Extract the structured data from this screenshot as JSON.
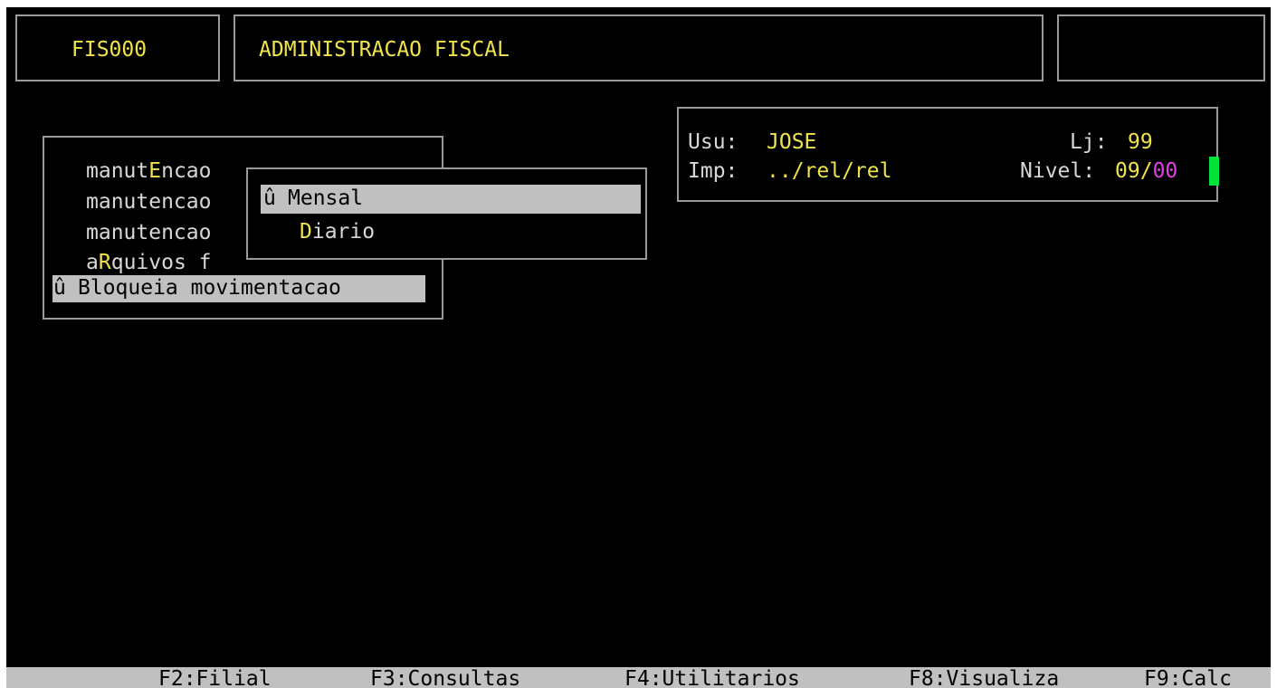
{
  "header": {
    "program_code": "FIS000",
    "title": "ADMINISTRACAO FISCAL",
    "right_box": ""
  },
  "main_menu": {
    "items": [
      {
        "prefix": "manut",
        "hotkey": "E",
        "suffix": "ncao"
      },
      {
        "prefix": "manutencao",
        "hotkey": "",
        "suffix": ""
      },
      {
        "prefix": "manutencao",
        "hotkey": "",
        "suffix": ""
      },
      {
        "prefix": "a",
        "hotkey": "R",
        "suffix": "quivos f"
      }
    ],
    "selected": {
      "marker": "û",
      "label": "Bloqueia movimentacao"
    }
  },
  "submenu": {
    "selected": {
      "marker": "û",
      "label": "Mensal"
    },
    "items": [
      {
        "hotkey": "D",
        "suffix": "iario"
      }
    ]
  },
  "info": {
    "user_label": "Usu:",
    "user_value": "JOSE",
    "store_label": "Lj:",
    "store_value": "99",
    "printer_label": "Imp:",
    "printer_value": "../rel/rel",
    "level_label": "Nivel:",
    "level_value_a": "09",
    "level_sep": "/",
    "level_value_b": "00"
  },
  "function_keys": [
    "F2:Filial",
    "F3:Consultas",
    "F4:Utilitarios",
    "F8:Visualiza",
    "F9:Calc"
  ],
  "colors": {
    "background": "#000000",
    "text": "#d8d8d8",
    "highlight_text": "#f0e44a",
    "level_b": "#e23ee6",
    "selection_bar": "#c0c0c0",
    "cursor": "#00e43a"
  }
}
